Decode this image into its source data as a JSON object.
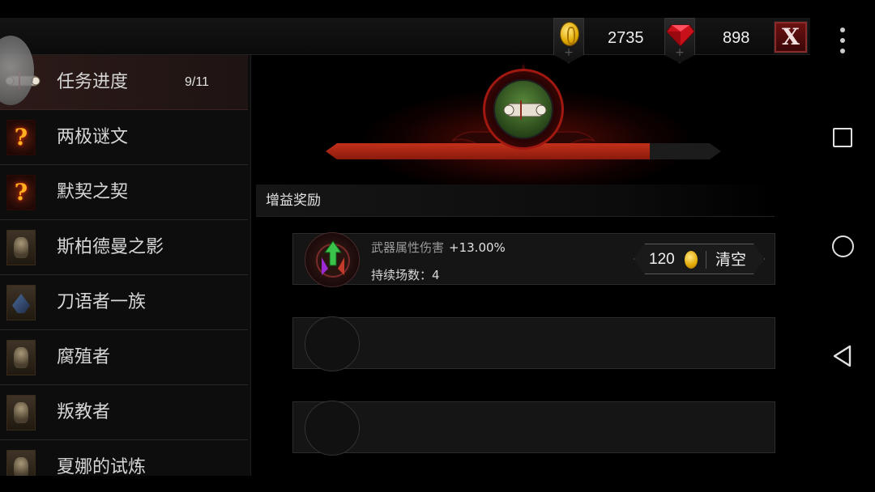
{
  "currency": {
    "gold": "2735",
    "gems": "898",
    "add_symbol": "+",
    "close_label": "X"
  },
  "quest_list": [
    {
      "label": "任务进度",
      "count": "9/11",
      "icon": "scroll-icon",
      "active": true
    },
    {
      "label": "两极谜文",
      "icon": "question-icon"
    },
    {
      "label": "默契之契",
      "icon": "question-icon"
    },
    {
      "label": "斯柏德曼之影",
      "icon": "portrait-icon"
    },
    {
      "label": "刀语者一族",
      "icon": "beast-portrait-icon"
    },
    {
      "label": "腐殖者",
      "icon": "portrait-icon"
    },
    {
      "label": "叛教者",
      "icon": "portrait-icon"
    },
    {
      "label": "夏娜的试炼",
      "icon": "portrait-icon"
    }
  ],
  "progress": {
    "fraction": 0.82
  },
  "buff_section": {
    "title": "增益奖励",
    "slots": [
      {
        "name": "武器属性伤害",
        "value": "+13.00%",
        "rounds": "持续场数：4",
        "price": "120",
        "clear_label": "清空"
      }
    ]
  },
  "colors": {
    "accent_red": "#b52a16",
    "gold": "#e0a800",
    "background": "#000000"
  }
}
